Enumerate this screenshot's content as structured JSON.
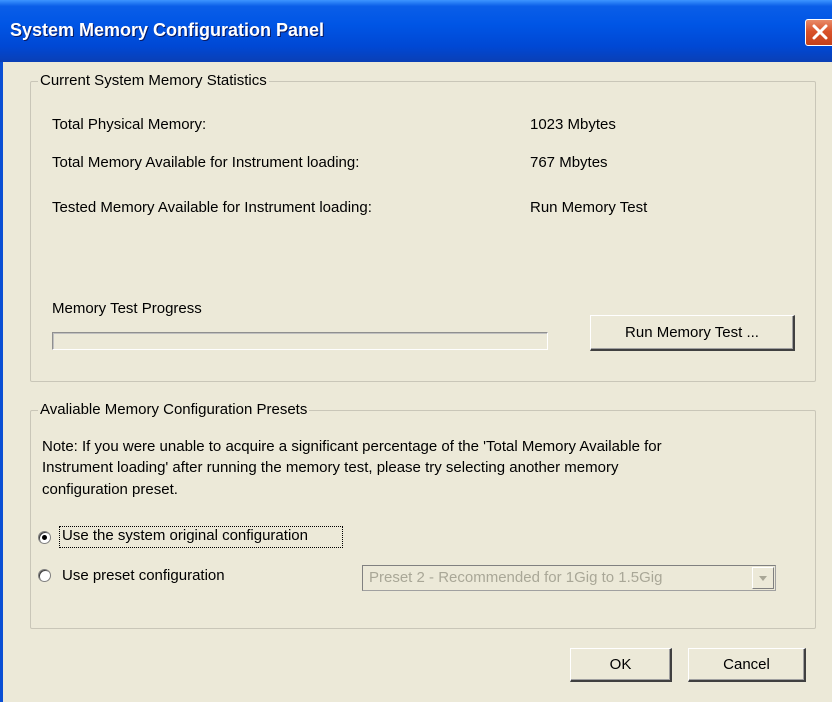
{
  "window": {
    "title": "System Memory Configuration Panel",
    "close_icon": "close-x-icon"
  },
  "stats": {
    "legend": "Current System Memory Statistics",
    "rows": [
      {
        "label": "Total Physical Memory:",
        "value": "1023 Mbytes"
      },
      {
        "label": "Total Memory Available for Instrument loading:",
        "value": "767 Mbytes"
      },
      {
        "label": "Tested Memory Available for Instrument loading:",
        "value": "Run Memory Test"
      }
    ],
    "progress_label": "Memory Test Progress",
    "progress_value": 0,
    "run_button": "Run Memory Test ..."
  },
  "presets": {
    "legend": "Avaliable Memory Configuration Presets",
    "note_lines": [
      "Note: If you were unable to acquire a significant percentage of the 'Total Memory Available for",
      "Instrument loading' after running the memory test, please try selecting another memory",
      "configuration preset."
    ],
    "option_original": "Use the system original configuration",
    "option_preset": "Use preset configuration",
    "selected_option": "original",
    "preset_select_value": "Preset 2 - Recommended for 1Gig to 1.5Gig"
  },
  "footer": {
    "ok": "OK",
    "cancel": "Cancel"
  },
  "colors": {
    "titlebar": "#0055e5",
    "close_button": "#d9532b",
    "dialog_bg": "#ece9d8"
  }
}
